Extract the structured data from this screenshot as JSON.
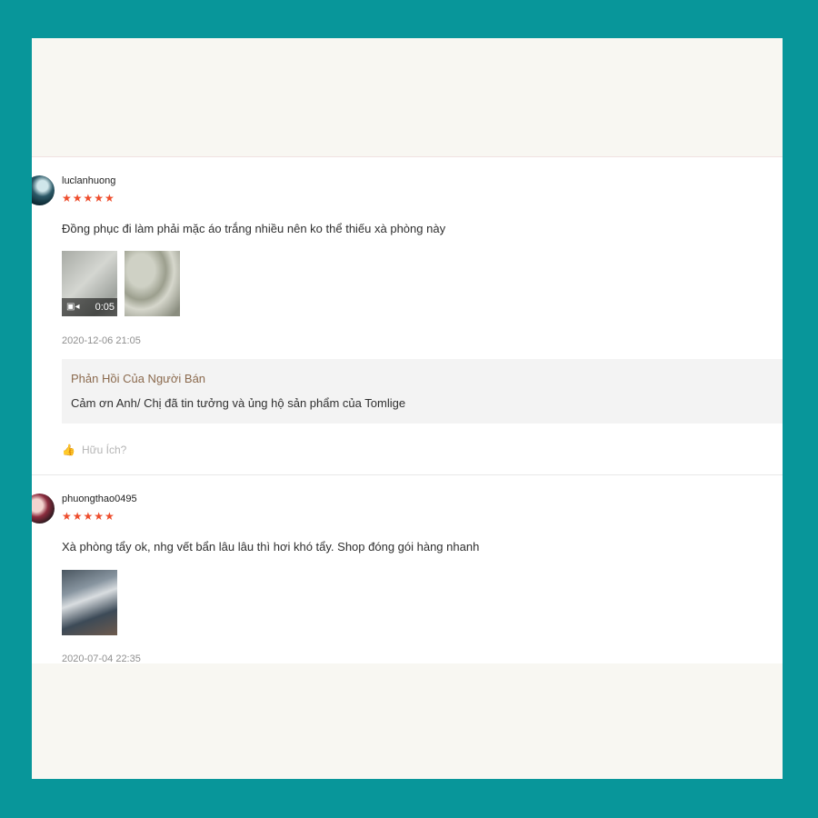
{
  "reviews": [
    {
      "username": "luclanhuong",
      "stars": "★★★★★",
      "comment": "Đồng phục đi làm phải mặc áo trắng nhiều nên ko thể thiếu xà phòng này",
      "video_duration": "0:05",
      "date": "2020-12-06 21:05",
      "reply_title": "Phản Hồi Của Người Bán",
      "reply_text": "Cảm ơn Anh/ Chị đã tin tưởng và ủng hộ sản phẩm của Tomlige",
      "helpful_label": "Hữu Ích?",
      "rating": 5
    },
    {
      "username": "phuongthao0495",
      "stars": "★★★★★",
      "comment": "Xà phòng tẩy ok, nhg vết bẩn lâu lâu thì hơi khó tẩy. Shop đóng gói hàng nhanh",
      "date": "2020-07-04 22:35",
      "rating": 5
    }
  ],
  "colors": {
    "border": "#08969a",
    "star": "#ee4d2d",
    "reply_title": "#8b6a4e"
  },
  "icons": {
    "video": "video-camera-icon",
    "helpful": "thumbs-up-icon"
  }
}
